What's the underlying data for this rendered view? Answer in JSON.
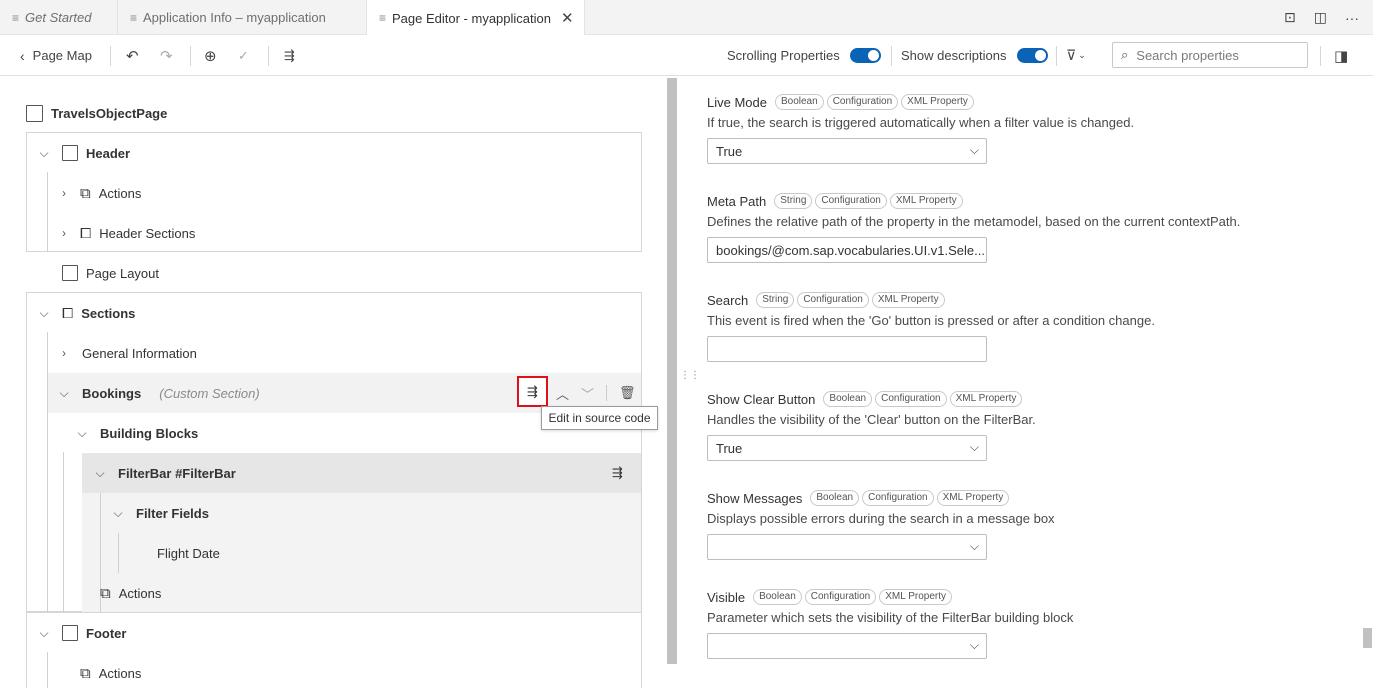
{
  "tabs": [
    {
      "label": "Get Started",
      "italic": true
    },
    {
      "label": "Application Info – myapplication",
      "italic": false
    },
    {
      "label": "Page Editor - myapplication",
      "italic": false,
      "active": true
    }
  ],
  "toolbar": {
    "back_label": "Page Map",
    "scrolling_properties_label": "Scrolling Properties",
    "show_descriptions_label": "Show descriptions",
    "search_placeholder": "Search properties",
    "scrolling_properties_on": true,
    "show_descriptions_on": true
  },
  "tree": {
    "page_title": "TravelsObjectPage",
    "header": "Header",
    "header_actions": "Actions",
    "header_sections": "Header Sections",
    "page_layout": "Page Layout",
    "sections": "Sections",
    "general_information": "General Information",
    "bookings": "Bookings",
    "bookings_tag": "(Custom Section)",
    "building_blocks": "Building Blocks",
    "filterbar": "FilterBar #FilterBar",
    "filter_fields": "Filter Fields",
    "flight_date": "Flight Date",
    "filterbar_actions": "Actions",
    "footer": "Footer",
    "footer_actions": "Actions"
  },
  "tooltip": "Edit in source code",
  "properties": [
    {
      "name": "Live Mode",
      "badges": [
        "Boolean",
        "Configuration",
        "XML Property"
      ],
      "description": "If true, the search is triggered automatically when a filter value is changed.",
      "value": "True",
      "dropdown": true
    },
    {
      "name": "Meta Path",
      "badges": [
        "String",
        "Configuration",
        "XML Property"
      ],
      "description": "Defines the relative path of the property in the metamodel, based on the current contextPath.",
      "value": "bookings/@com.sap.vocabularies.UI.v1.Sele...",
      "dropdown": false
    },
    {
      "name": "Search",
      "badges": [
        "String",
        "Configuration",
        "XML Property"
      ],
      "description": "This event is fired when the 'Go' button is pressed or after a condition change.",
      "value": "",
      "dropdown": false
    },
    {
      "name": "Show Clear Button",
      "badges": [
        "Boolean",
        "Configuration",
        "XML Property"
      ],
      "description": "Handles the visibility of the 'Clear' button on the FilterBar.",
      "value": "True",
      "dropdown": true
    },
    {
      "name": "Show Messages",
      "badges": [
        "Boolean",
        "Configuration",
        "XML Property"
      ],
      "description": "Displays possible errors during the search in a message box",
      "value": "",
      "dropdown": true
    },
    {
      "name": "Visible",
      "badges": [
        "Boolean",
        "Configuration",
        "XML Property"
      ],
      "description": "Parameter which sets the visibility of the FilterBar building block",
      "value": "",
      "dropdown": true
    }
  ],
  "colors": {
    "accent": "#0b63b6",
    "highlight": "#e0101a"
  }
}
